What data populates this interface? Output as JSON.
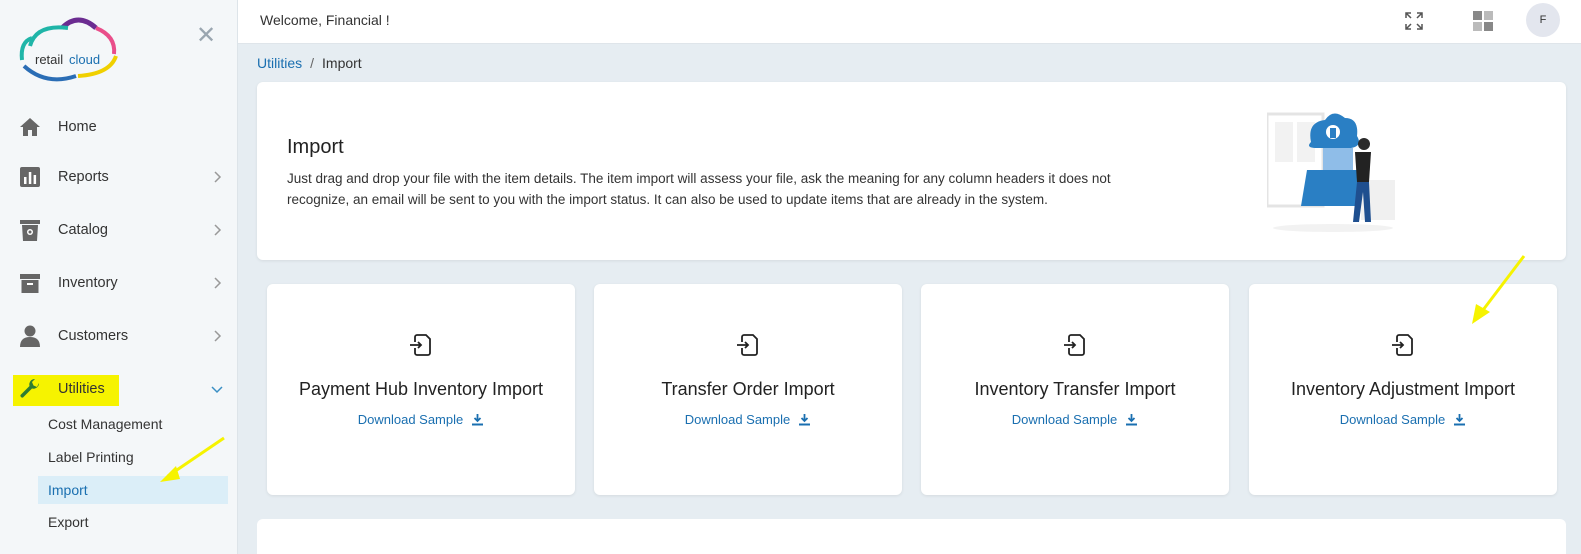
{
  "brand": {
    "logo_text_a": "retail",
    "logo_text_b": "cloud"
  },
  "header": {
    "welcome": "Welcome, Financial !",
    "avatar_initial": "F"
  },
  "sidebar": {
    "items": [
      {
        "label": "Home"
      },
      {
        "label": "Reports"
      },
      {
        "label": "Catalog"
      },
      {
        "label": "Inventory"
      },
      {
        "label": "Customers"
      },
      {
        "label": "Utilities"
      }
    ],
    "sub_items": [
      {
        "label": "Cost Management"
      },
      {
        "label": "Label Printing"
      },
      {
        "label": "Import"
      },
      {
        "label": "Export"
      }
    ]
  },
  "breadcrumb": {
    "parent": "Utilities",
    "separator": "/",
    "current": "Import"
  },
  "hero": {
    "title": "Import",
    "description": "Just drag and drop your file with the item details. The item import will assess your file, ask the meaning for any column headers it does not recognize, an email will be sent to you with the import status. It can also be used to update items that are already in the system."
  },
  "cards": [
    {
      "title": "Payment Hub Inventory Import",
      "link": "Download Sample"
    },
    {
      "title": "Transfer Order Import",
      "link": "Download Sample"
    },
    {
      "title": "Inventory Transfer Import",
      "link": "Download Sample"
    },
    {
      "title": "Inventory Adjustment Import",
      "link": "Download Sample"
    }
  ],
  "colors": {
    "accent": "#1a6fb0",
    "highlight": "#f6f300",
    "active_bg": "#dbeef8",
    "utilities_icon": "#2e7d32"
  }
}
